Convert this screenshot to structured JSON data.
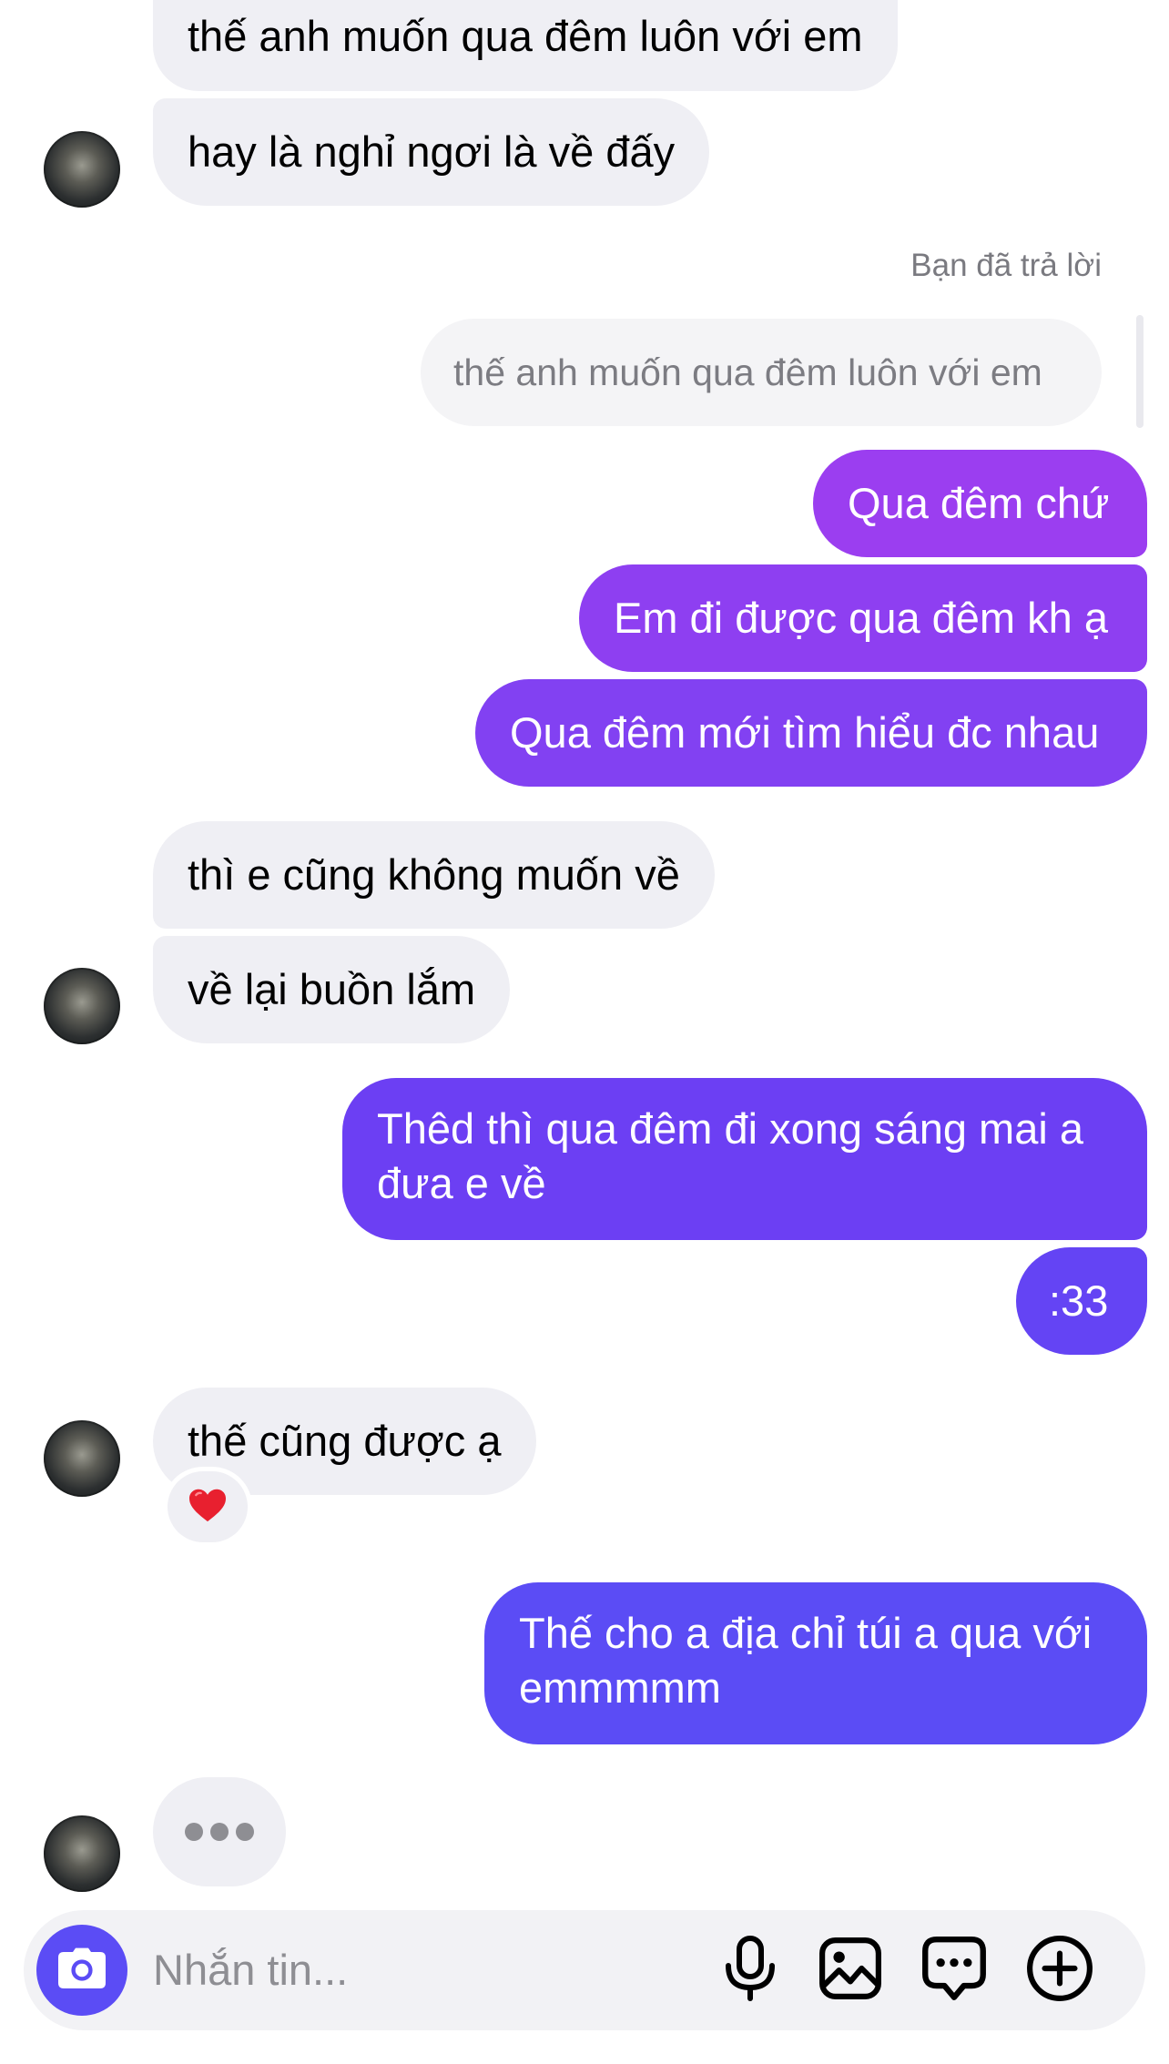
{
  "colors": {
    "incoming_bg": "#efeff4",
    "outgoing_gradient": [
      "#9b3ef0",
      "#5b4cf5"
    ],
    "accent": "#5b4cf5",
    "reaction": "#e8202f"
  },
  "messages": {
    "m1": "thế anh muốn qua đêm luôn với em",
    "m2": "hay là nghỉ ngơi là về đấy",
    "reply_label": "Bạn đã trả lời",
    "reply_quote": "thế anh muốn qua đêm luôn với em",
    "m3": "Qua đêm chứ",
    "m4": "Em đi được qua đêm kh ạ",
    "m5": "Qua đêm mới tìm hiểu đc nhau",
    "m6": "thì e cũng không muốn về",
    "m7": "về lại buồn lắm",
    "m8_line1": "Thêd thì qua đêm đi xong sáng mai a",
    "m8_line2": "đưa e về",
    "m9": ":33",
    "m10": "thế cũng được ạ",
    "m11_line1": "Thế cho a địa chỉ túi a qua với",
    "m11_line2": "emmmmm"
  },
  "reaction_icon": "heart-icon",
  "composer": {
    "placeholder": "Nhắn tin...",
    "icons": [
      "camera-icon",
      "microphone-icon",
      "image-icon",
      "sticker-icon",
      "add-icon"
    ]
  }
}
